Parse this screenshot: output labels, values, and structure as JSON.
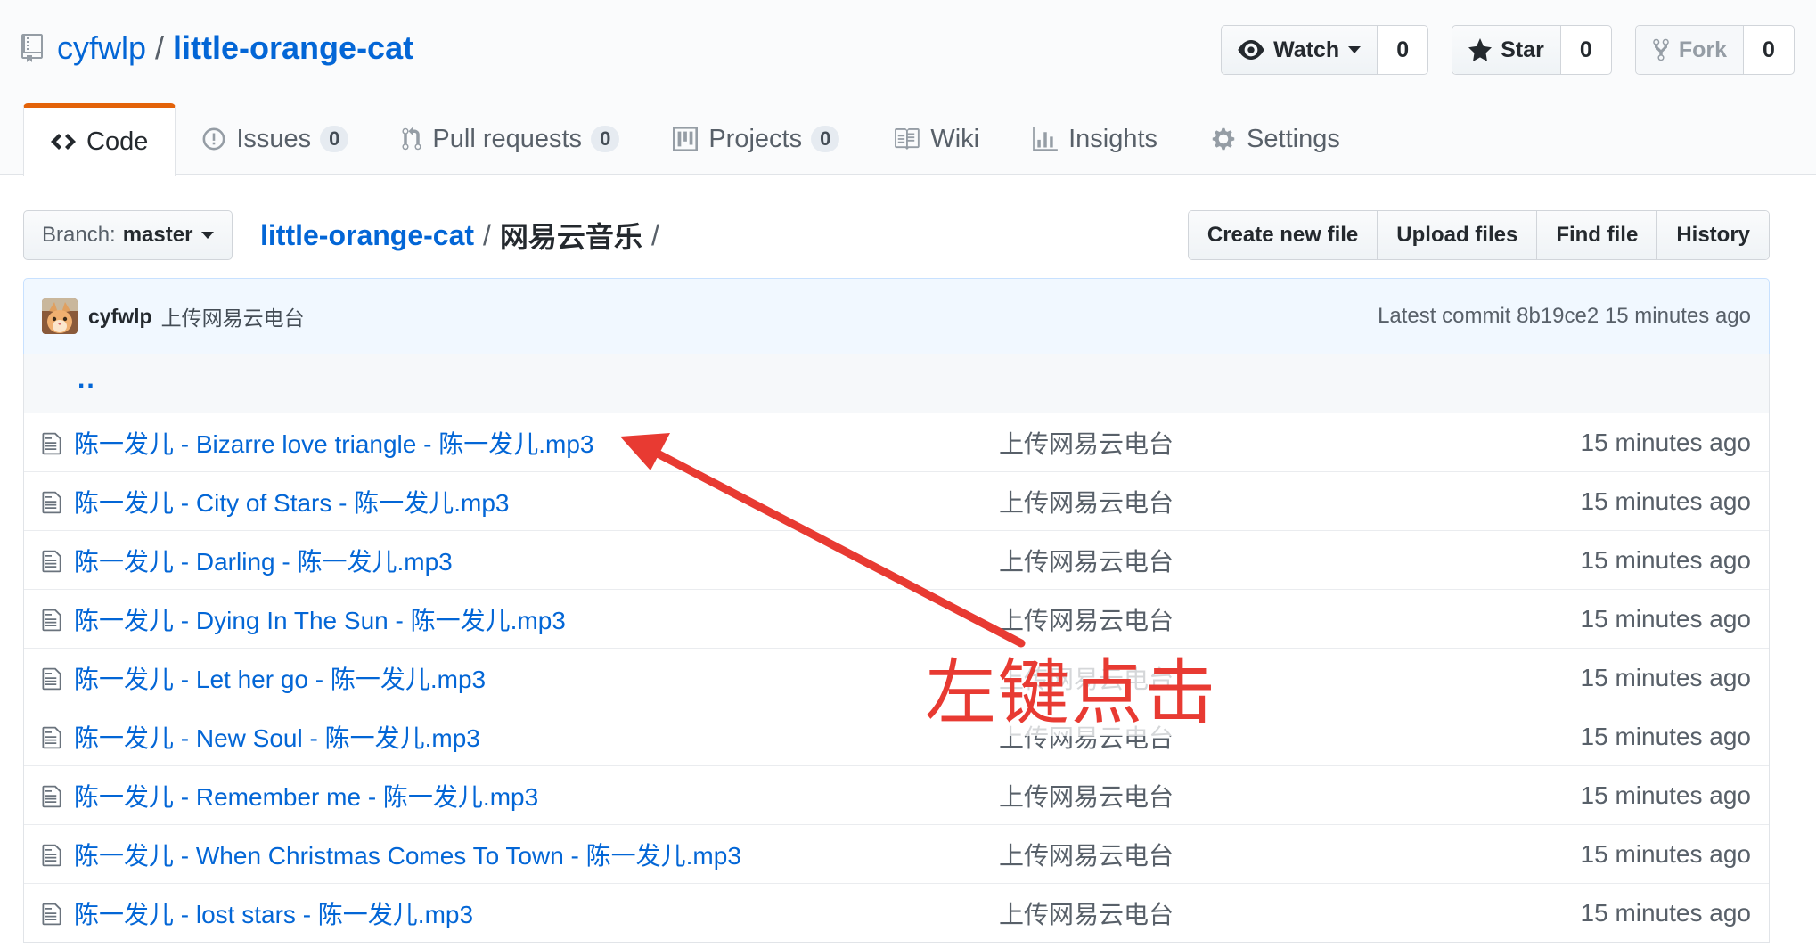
{
  "repo": {
    "owner": "cyfwlp",
    "separator": "/",
    "name": "little-orange-cat"
  },
  "actions": {
    "watch": {
      "label": "Watch",
      "count": "0"
    },
    "star": {
      "label": "Star",
      "count": "0"
    },
    "fork": {
      "label": "Fork",
      "count": "0"
    }
  },
  "nav": {
    "code": "Code",
    "issues": {
      "label": "Issues",
      "count": "0"
    },
    "pulls": {
      "label": "Pull requests",
      "count": "0"
    },
    "projects": {
      "label": "Projects",
      "count": "0"
    },
    "wiki": "Wiki",
    "insights": "Insights",
    "settings": "Settings"
  },
  "branch": {
    "label": "Branch:",
    "value": "master"
  },
  "breadcrumb": {
    "root": "little-orange-cat",
    "sep": "/",
    "current": "网易云音乐",
    "trail": "/"
  },
  "file_actions": [
    "Create new file",
    "Upload files",
    "Find file",
    "History"
  ],
  "commit": {
    "author": "cyfwlp",
    "message": "上传网易云电台",
    "latest_label": "Latest commit",
    "sha": "8b19ce2",
    "age": "15 minutes ago"
  },
  "parent_dir": "..",
  "files": [
    {
      "name": "陈一发儿 - Bizarre love triangle - 陈一发儿.mp3",
      "message": "上传网易云电台",
      "age": "15 minutes ago"
    },
    {
      "name": "陈一发儿 - City of Stars - 陈一发儿.mp3",
      "message": "上传网易云电台",
      "age": "15 minutes ago"
    },
    {
      "name": "陈一发儿 - Darling - 陈一发儿.mp3",
      "message": "上传网易云电台",
      "age": "15 minutes ago"
    },
    {
      "name": "陈一发儿 - Dying In The Sun - 陈一发儿.mp3",
      "message": "上传网易云电台",
      "age": "15 minutes ago"
    },
    {
      "name": "陈一发儿 - Let her go - 陈一发儿.mp3",
      "message": "上传网易云电台",
      "age": "15 minutes ago"
    },
    {
      "name": "陈一发儿 - New Soul - 陈一发儿.mp3",
      "message": "上传网易云电台",
      "age": "15 minutes ago"
    },
    {
      "name": "陈一发儿 - Remember me - 陈一发儿.mp3",
      "message": "上传网易云电台",
      "age": "15 minutes ago"
    },
    {
      "name": "陈一发儿 - When Christmas Comes To Town - 陈一发儿.mp3",
      "message": "上传网易云电台",
      "age": "15 minutes ago"
    },
    {
      "name": "陈一发儿 - lost stars - 陈一发儿.mp3",
      "message": "上传网易云电台",
      "age": "15 minutes ago"
    }
  ],
  "annotation": {
    "text": "左键点击",
    "color": "#e83a32"
  },
  "colors": {
    "link": "#0366d6",
    "tab_accent": "#e36209",
    "commit_bg": "#f1f8ff"
  }
}
